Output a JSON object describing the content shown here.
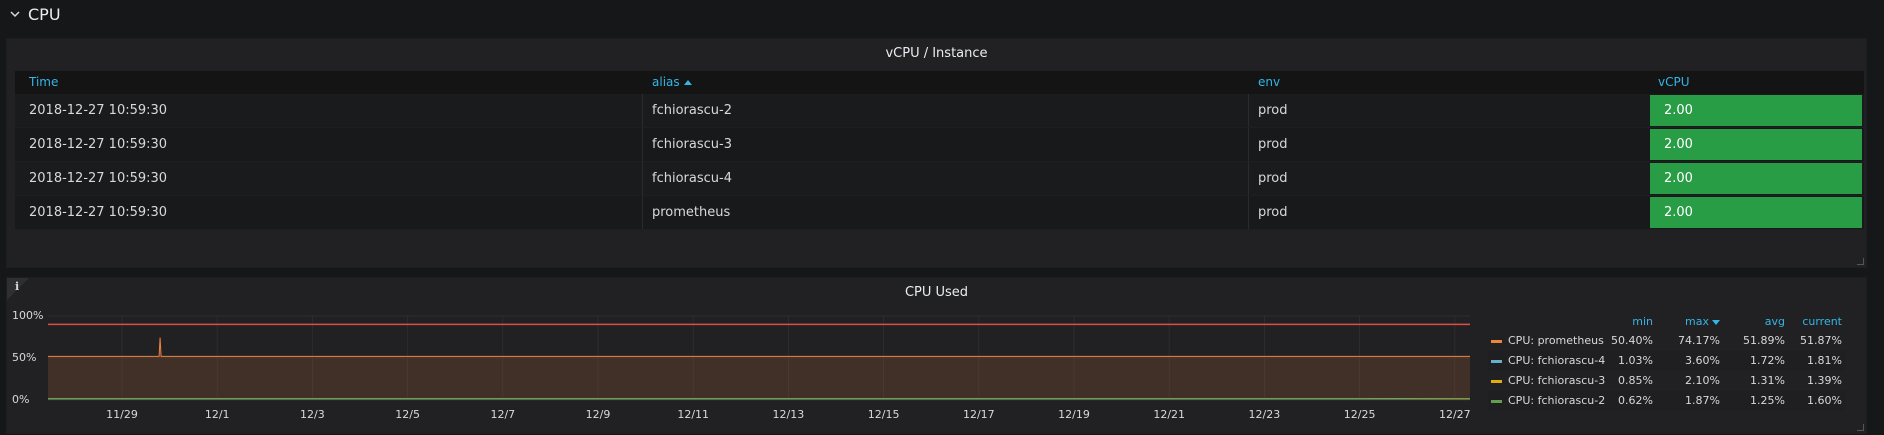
{
  "row": {
    "title": "CPU"
  },
  "table_panel": {
    "title": "vCPU / Instance",
    "columns": [
      {
        "label": "Time"
      },
      {
        "label": "alias"
      },
      {
        "label": "env"
      },
      {
        "label": "vCPU"
      }
    ],
    "rows": [
      {
        "time": "2018-12-27 10:59:30",
        "alias": "fchiorascu-2",
        "env": "prod",
        "vcpu": "2.00"
      },
      {
        "time": "2018-12-27 10:59:30",
        "alias": "fchiorascu-3",
        "env": "prod",
        "vcpu": "2.00"
      },
      {
        "time": "2018-12-27 10:59:30",
        "alias": "fchiorascu-4",
        "env": "prod",
        "vcpu": "2.00"
      },
      {
        "time": "2018-12-27 10:59:30",
        "alias": "prometheus",
        "env": "prod",
        "vcpu": "2.00"
      }
    ],
    "vcpu_color": "#299c46"
  },
  "graph_panel": {
    "title": "CPU Used",
    "info_icon": "i",
    "legend_headers": [
      "min",
      "max",
      "avg",
      "current"
    ],
    "legend": [
      {
        "name": "CPU: prometheus",
        "color": "#ef843c",
        "min": "50.40%",
        "max": "74.17%",
        "avg": "51.89%",
        "current": "51.87%"
      },
      {
        "name": "CPU: fchiorascu-4",
        "color": "#64b0c8",
        "min": "1.03%",
        "max": "3.60%",
        "avg": "1.72%",
        "current": "1.81%"
      },
      {
        "name": "CPU: fchiorascu-3",
        "color": "#e5ac0e",
        "min": "0.85%",
        "max": "2.10%",
        "avg": "1.31%",
        "current": "1.39%"
      },
      {
        "name": "CPU: fchiorascu-2",
        "color": "#629e51",
        "min": "0.62%",
        "max": "1.87%",
        "avg": "1.25%",
        "current": "1.60%"
      }
    ]
  },
  "chart_data": {
    "type": "area",
    "x": [
      "11/29",
      "12/1",
      "12/3",
      "12/5",
      "12/7",
      "12/9",
      "12/11",
      "12/13",
      "12/15",
      "12/17",
      "12/19",
      "12/21",
      "12/23",
      "12/25",
      "12/27"
    ],
    "y_ticks": [
      "0%",
      "50%",
      "100%"
    ],
    "ylim": [
      0,
      100
    ],
    "threshold": 90,
    "threshold_color": "#e24d42",
    "spike": {
      "series": "CPU: prometheus",
      "x": "11/30",
      "y": 74.17
    },
    "series": [
      {
        "name": "CPU: prometheus",
        "values": [
          51.9,
          51.9,
          51.9,
          51.9,
          51.9,
          51.9,
          51.9,
          51.9,
          51.9,
          51.9,
          51.9,
          51.9,
          51.9,
          51.9,
          51.87
        ]
      },
      {
        "name": "CPU: fchiorascu-4",
        "values": [
          1.7,
          1.7,
          1.7,
          1.7,
          1.7,
          1.7,
          1.7,
          1.7,
          1.7,
          1.7,
          1.7,
          1.7,
          1.7,
          1.7,
          1.81
        ]
      },
      {
        "name": "CPU: fchiorascu-3",
        "values": [
          1.3,
          1.3,
          1.3,
          1.3,
          1.3,
          1.3,
          1.3,
          1.3,
          1.3,
          1.3,
          1.3,
          1.3,
          1.3,
          1.3,
          1.39
        ]
      },
      {
        "name": "CPU: fchiorascu-2",
        "values": [
          1.25,
          1.25,
          1.25,
          1.25,
          1.25,
          1.25,
          1.25,
          1.25,
          1.25,
          1.25,
          1.25,
          1.25,
          1.25,
          1.25,
          1.6
        ]
      }
    ]
  }
}
